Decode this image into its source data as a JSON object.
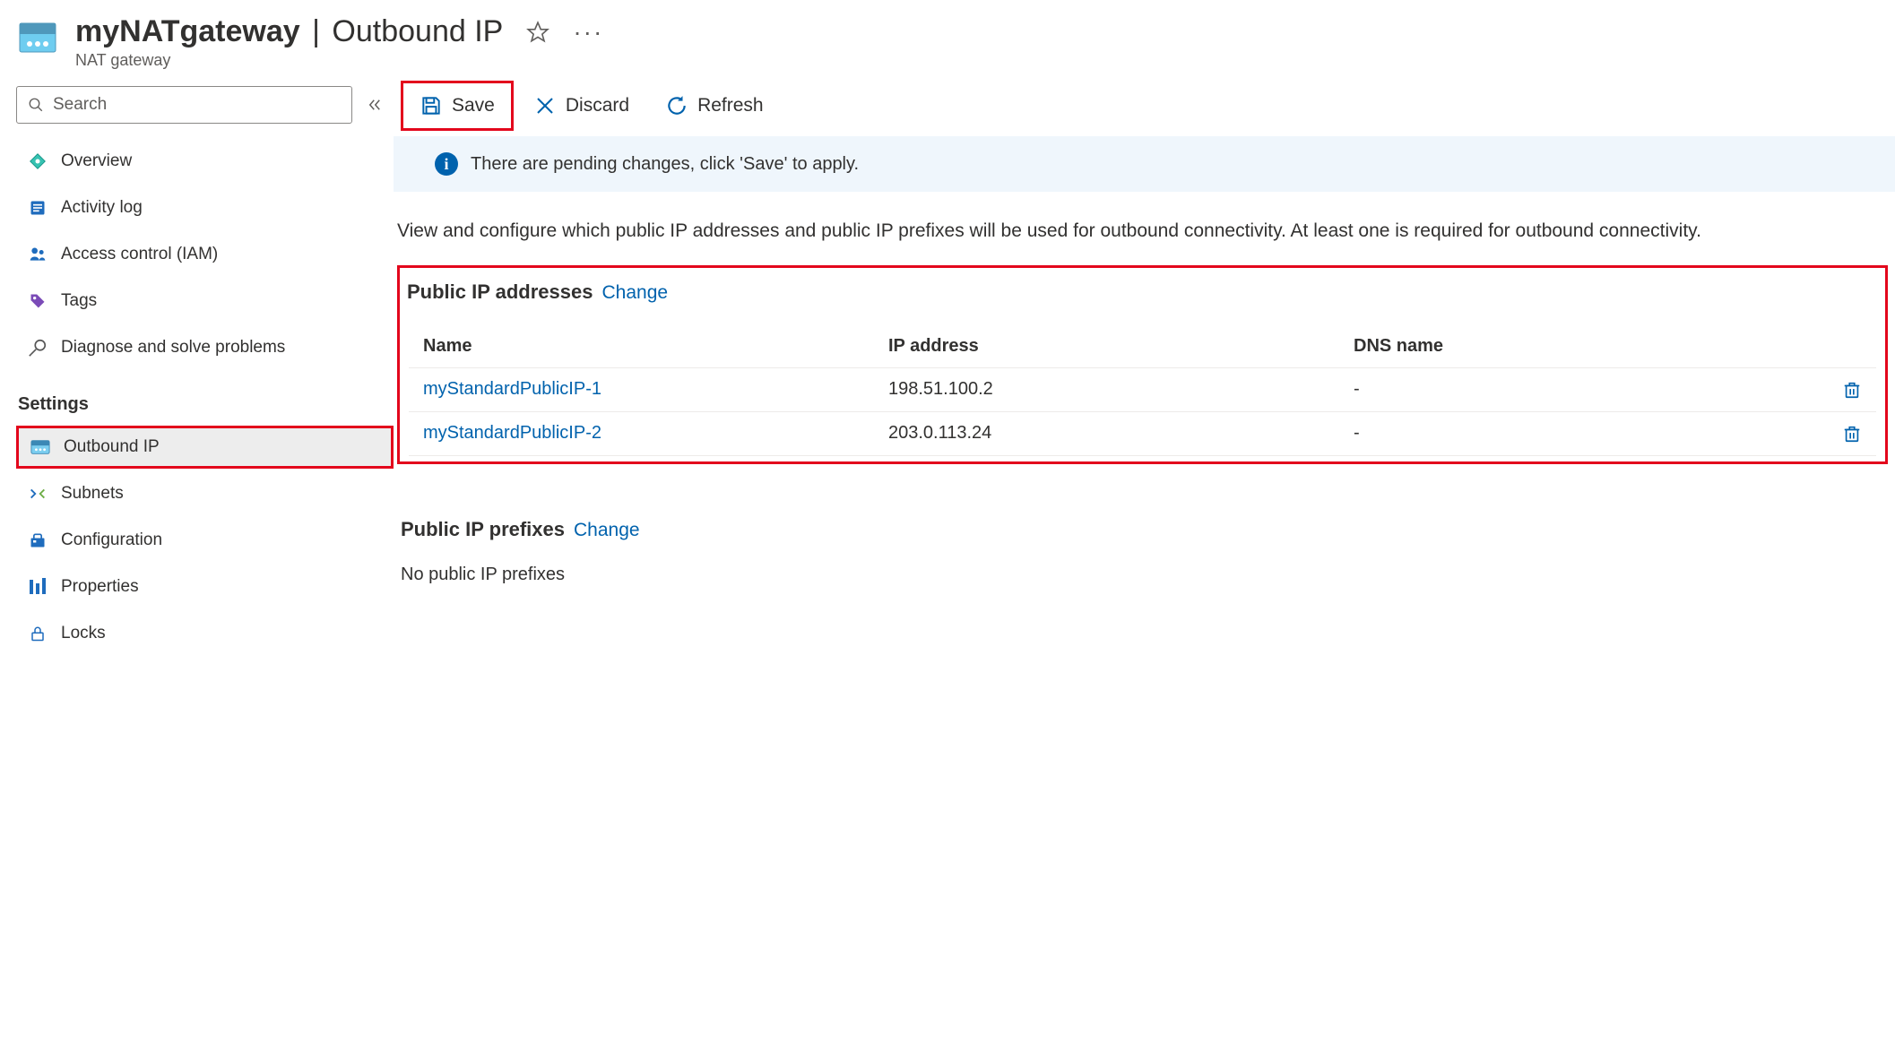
{
  "header": {
    "resourceName": "myNATgateway",
    "pageTitle": "Outbound IP",
    "resourceType": "NAT gateway"
  },
  "sidebar": {
    "searchPlaceholder": "Search",
    "items": {
      "overview": "Overview",
      "activityLog": "Activity log",
      "iam": "Access control (IAM)",
      "tags": "Tags",
      "diagnose": "Diagnose and solve problems"
    },
    "sectionLabel": "Settings",
    "settings": {
      "outboundIp": "Outbound IP",
      "subnets": "Subnets",
      "configuration": "Configuration",
      "properties": "Properties",
      "locks": "Locks"
    }
  },
  "toolbar": {
    "save": "Save",
    "discard": "Discard",
    "refresh": "Refresh"
  },
  "infoMessage": "There are pending changes, click 'Save' to apply.",
  "description": "View and configure which public IP addresses and public IP prefixes will be used for outbound connectivity. At least one is required for outbound connectivity.",
  "publicIp": {
    "title": "Public IP addresses",
    "changeLabel": "Change",
    "columns": {
      "name": "Name",
      "ip": "IP address",
      "dns": "DNS name"
    },
    "rows": [
      {
        "name": "myStandardPublicIP-1",
        "ip": "198.51.100.2",
        "dns": "-"
      },
      {
        "name": "myStandardPublicIP-2",
        "ip": "203.0.113.24",
        "dns": "-"
      }
    ]
  },
  "prefixes": {
    "title": "Public IP prefixes",
    "changeLabel": "Change",
    "empty": "No public IP prefixes"
  }
}
